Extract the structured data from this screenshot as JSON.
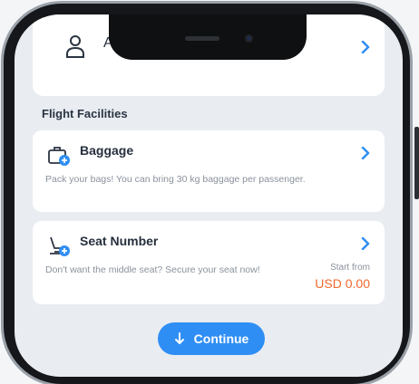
{
  "passenger": {
    "label": "Adu"
  },
  "section": {
    "title": "Flight Facilities"
  },
  "baggage": {
    "title": "Baggage",
    "description": "Pack your bags! You can bring 30 kg baggage per passenger."
  },
  "seat": {
    "title": "Seat Number",
    "description": "Don't want the middle seat? Secure your seat now!",
    "price_label": "Start from",
    "price_value": "USD 0.00"
  },
  "continue_button": {
    "label": "Continue"
  },
  "icons": {
    "passenger": "person-icon",
    "baggage": "baggage-add-icon",
    "seat": "seat-add-icon",
    "chevron": "chevron-right-icon",
    "continue": "arrow-down-icon"
  },
  "colors": {
    "accent": "#2f8ef4",
    "price": "#ef6a2f",
    "background": "#e9edf2"
  }
}
